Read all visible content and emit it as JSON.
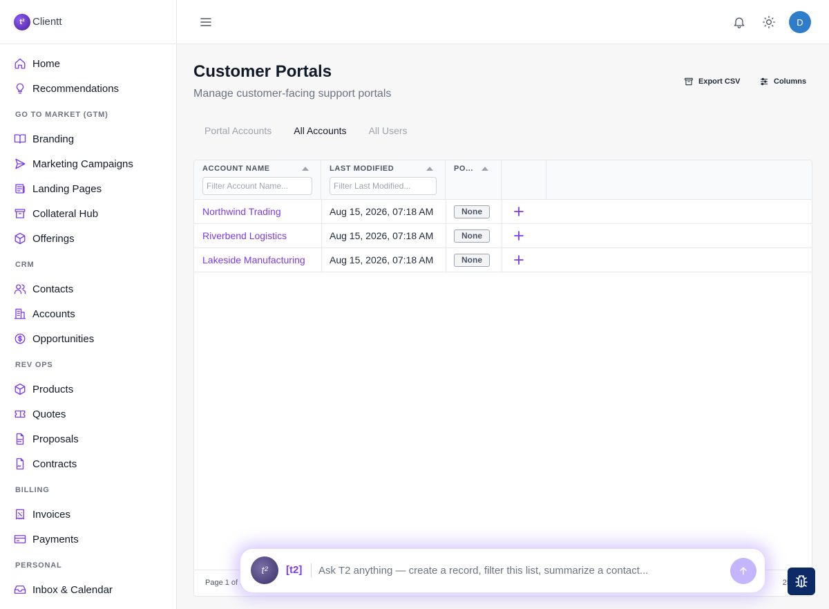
{
  "app": {
    "name": "Clientt",
    "logo_glyph": "t²"
  },
  "sidebar": {
    "items": [
      {
        "label": "Home",
        "icon": "home-icon"
      },
      {
        "label": "Recommendations",
        "icon": "lightbulb-icon"
      },
      {
        "section": "GO TO MARKET (GTM)"
      },
      {
        "label": "Branding",
        "icon": "book-icon"
      },
      {
        "label": "Marketing Campaigns",
        "icon": "send-icon"
      },
      {
        "label": "Landing Pages",
        "icon": "newspaper-icon"
      },
      {
        "label": "Collateral Hub",
        "icon": "archive-icon"
      },
      {
        "label": "Offerings",
        "icon": "box-icon"
      },
      {
        "section": "CRM"
      },
      {
        "label": "Contacts",
        "icon": "users-icon"
      },
      {
        "label": "Accounts",
        "icon": "building-icon"
      },
      {
        "label": "Opportunities",
        "icon": "dollar-circle-icon"
      },
      {
        "section": "REV OPS"
      },
      {
        "label": "Products",
        "icon": "box-icon"
      },
      {
        "label": "Quotes",
        "icon": "ticket-icon"
      },
      {
        "label": "Proposals",
        "icon": "file-text-icon"
      },
      {
        "label": "Contracts",
        "icon": "file-signature-icon"
      },
      {
        "section": "BILLING"
      },
      {
        "label": "Invoices",
        "icon": "receipt-icon"
      },
      {
        "label": "Payments",
        "icon": "credit-card-icon"
      },
      {
        "section": "PERSONAL"
      },
      {
        "label": "Inbox & Calendar",
        "icon": "inbox-icon"
      }
    ]
  },
  "topbar": {
    "avatar_initial": "D"
  },
  "page": {
    "title": "Customer Portals",
    "subtitle": "Manage customer-facing support portals",
    "export_label": "Export CSV",
    "columns_label": "Columns"
  },
  "tabs": [
    {
      "label": "Portal Accounts",
      "active": false
    },
    {
      "label": "All Accounts",
      "active": true
    },
    {
      "label": "All Users",
      "active": false
    }
  ],
  "grid": {
    "columns": [
      {
        "title": "ACCOUNT NAME",
        "filter_placeholder": "Filter Account Name..."
      },
      {
        "title": "LAST MODIFIED",
        "filter_placeholder": "Filter Last Modified..."
      },
      {
        "title": "PO..."
      }
    ],
    "rows": [
      {
        "account_name": "Northwind Trading",
        "last_modified": "Aug 15, 2026, 07:18 AM",
        "portal": "None"
      },
      {
        "account_name": "Riverbend Logistics",
        "last_modified": "Aug 15, 2026, 07:18 AM",
        "portal": "None"
      },
      {
        "account_name": "Lakeside Manufacturing",
        "last_modified": "Aug 15, 2026, 07:18 AM",
        "portal": "None"
      }
    ],
    "footer": {
      "page_info": "Page 1 of 1",
      "page_size": "25"
    }
  },
  "assistant": {
    "avatar_glyph": "t²",
    "tag": "[t2]",
    "placeholder": "Ask T2 anything — create a record, filter this list, summarize a contact..."
  },
  "colors": {
    "accent": "#7c3aed",
    "avatar": "#2f7cc8",
    "corner_button": "#0b2a66"
  }
}
